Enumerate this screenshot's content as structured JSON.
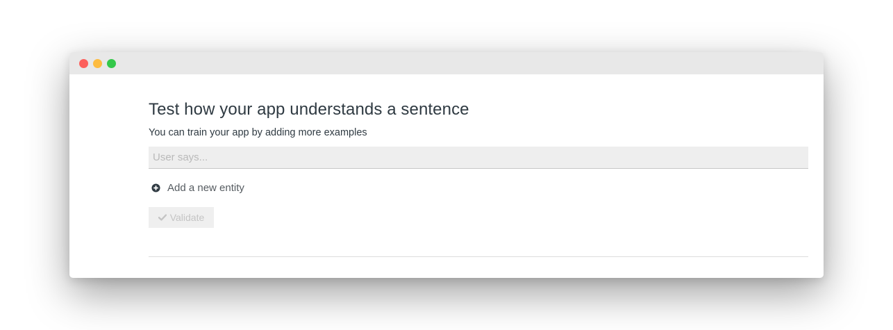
{
  "window": {
    "traffic_lights": [
      {
        "name": "close",
        "color": "#fc605c"
      },
      {
        "name": "minimize",
        "color": "#fdbc40"
      },
      {
        "name": "zoom",
        "color": "#34c84a"
      }
    ]
  },
  "main": {
    "title": "Test how your app understands a sentence",
    "subtitle": "You can train your app by adding more examples",
    "input": {
      "placeholder": "User says...",
      "value": ""
    },
    "add_entity": {
      "label": "Add a new entity",
      "icon": "plus-circle-icon",
      "icon_color": "#2f3a42"
    },
    "validate": {
      "label": "Validate",
      "icon": "check-icon",
      "disabled": true
    }
  }
}
